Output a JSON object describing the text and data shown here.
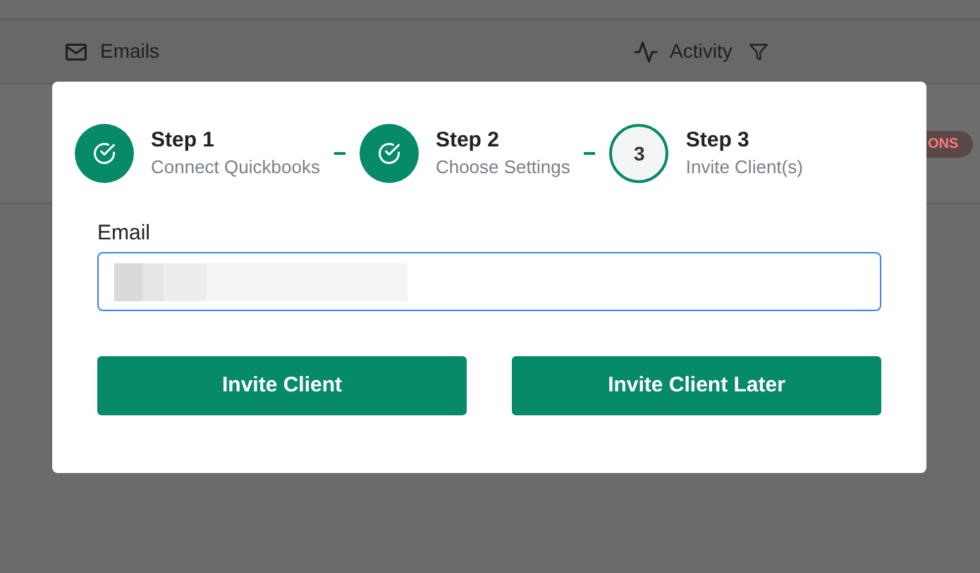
{
  "background": {
    "columns": [
      {
        "label": "Emails",
        "kind": "mail"
      },
      {
        "label": "Activity",
        "kind": "activity"
      }
    ],
    "badge": "ONS"
  },
  "dialog": {
    "steps": [
      {
        "title": "Step 1",
        "subtitle": "Connect Quickbooks",
        "completed": true
      },
      {
        "title": "Step 2",
        "subtitle": "Choose Settings",
        "completed": true
      },
      {
        "title": "Step 3",
        "subtitle": "Invite Client(s)",
        "number": "3",
        "completed": false
      }
    ],
    "email": {
      "label": "Email",
      "focused": true
    },
    "buttons": [
      "Invite Client",
      "Invite Client Later"
    ]
  }
}
